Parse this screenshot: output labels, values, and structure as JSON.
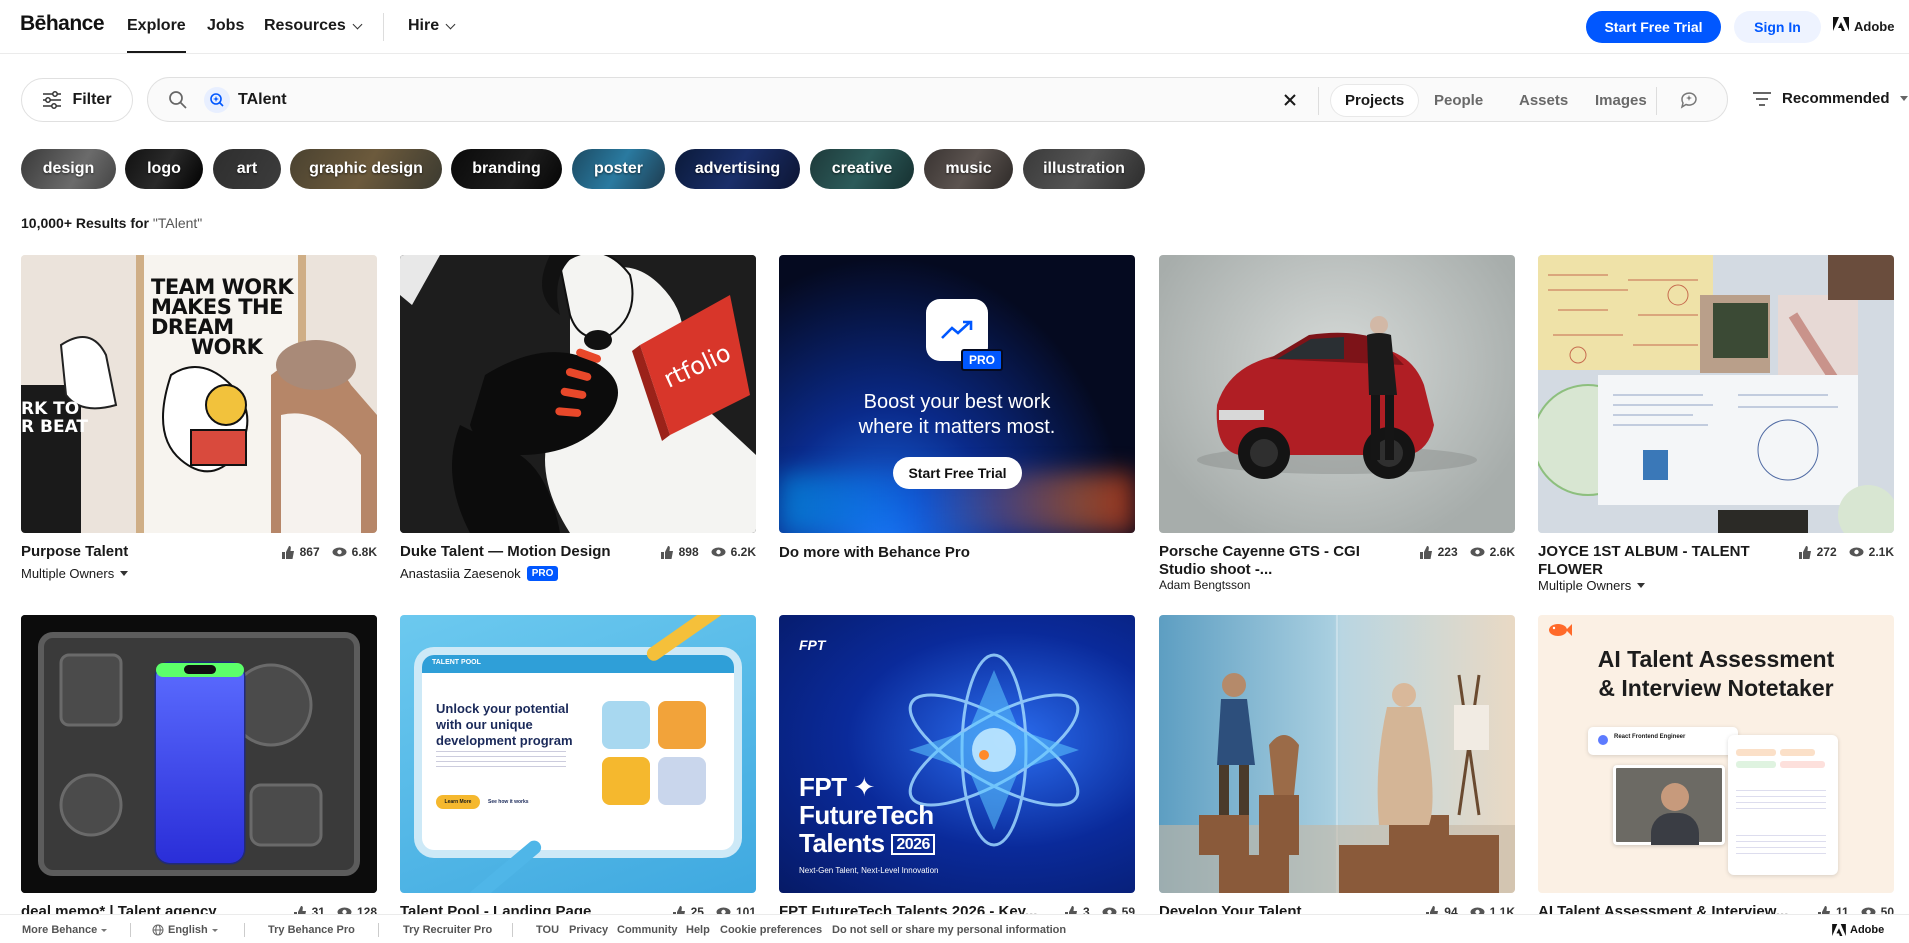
{
  "nav": {
    "logo": "Bēhance",
    "explore": "Explore",
    "jobs": "Jobs",
    "resources": "Resources",
    "hire": "Hire",
    "start_trial": "Start Free Trial",
    "sign_in": "Sign In",
    "adobe": "Adobe"
  },
  "search": {
    "filter_label": "Filter",
    "query": "TAlent",
    "tabs": [
      "Projects",
      "People",
      "Assets",
      "Images"
    ],
    "active_tab": "Projects",
    "sort_label": "Recommended"
  },
  "tags": [
    "design",
    "logo",
    "art",
    "graphic design",
    "branding",
    "poster",
    "advertising",
    "creative",
    "music",
    "illustration"
  ],
  "results": {
    "count": "10,000+ Results for",
    "query": "\"TAlent\""
  },
  "cards": [
    {
      "title": "Purpose Talent",
      "likes": "867",
      "views": "6.8K",
      "owner": "Multiple Owners",
      "owner_dropdown": true
    },
    {
      "title": "Duke Talent — Motion Design",
      "likes": "898",
      "views": "6.2K",
      "owner": "Anastasiia Zaesenok",
      "pro": "PRO"
    },
    {
      "title": "Do more with Behance Pro",
      "promo_pro": "PRO",
      "promo_text_1": "Boost your best work",
      "promo_text_2": "where it matters most.",
      "promo_button": "Start Free Trial"
    },
    {
      "title": "Porsche Cayenne GTS - CGI Studio shoot -...",
      "likes": "223",
      "views": "2.6K",
      "owner": "Adam Bengtsson"
    },
    {
      "title": "JOYCE 1ST ALBUM - TALENT FLOWER",
      "likes": "272",
      "views": "2.1K",
      "owner": "Multiple Owners",
      "owner_dropdown": true
    },
    {
      "title": "deal memo* | Talent agency",
      "likes": "31",
      "views": "128"
    },
    {
      "title": "Talent Pool - Landing Page",
      "likes": "25",
      "views": "101",
      "art_brand": "TALENT POOL",
      "art_heading_1": "Unlock your potential",
      "art_heading_2": "with our unique",
      "art_heading_3": "development program",
      "art_btn": "Learn More",
      "art_link": "See how it works"
    },
    {
      "title": "FPT FutureTech Talents 2026 - Key...",
      "likes": "3",
      "views": "59",
      "art_brand": "FPT",
      "art_line_1": "FPT ✦",
      "art_line_2": "FutureTech",
      "art_line_3": "Talents",
      "art_year": "2026",
      "art_sub": "Next-Gen Talent, Next-Level Innovation"
    },
    {
      "title": "Develop Your Talent",
      "likes": "94",
      "views": "1.1K"
    },
    {
      "title": "AI Talent Assessment & Interview...",
      "likes": "11",
      "views": "50",
      "art_heading_1": "AI Talent Assessment",
      "art_heading_2": "& Interview Notetaker",
      "art_role": "React Frontend Engineer"
    }
  ],
  "art1": {
    "line1": "TEAM WORK",
    "line2": "MAKES THE",
    "line3": "DREAM",
    "line4": "WORK",
    "side": "RK TO",
    "side2": "R BEAT"
  },
  "art2": {
    "book": "rtfolio"
  },
  "footer": {
    "more": "More Behance",
    "lang": "English",
    "try_pro": "Try Behance Pro",
    "try_recruiter": "Try Recruiter Pro",
    "tou": "TOU",
    "privacy": "Privacy",
    "community": "Community",
    "help": "Help",
    "cookies": "Cookie preferences",
    "do_not_sell": "Do not sell or share my personal information",
    "adobe": "Adobe"
  }
}
